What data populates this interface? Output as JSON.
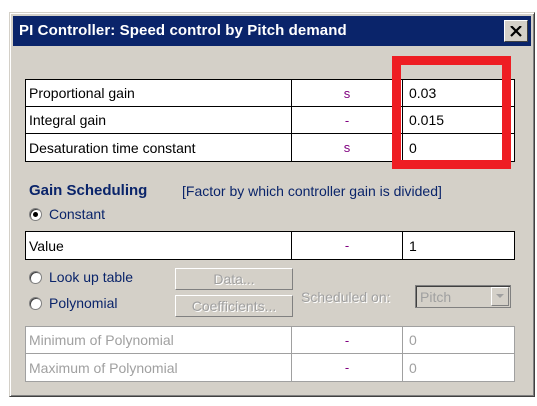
{
  "window": {
    "title": "PI Controller: Speed control by Pitch demand"
  },
  "params": [
    {
      "label": "Proportional gain",
      "unit": "s",
      "value": "0.03"
    },
    {
      "label": "Integral gain",
      "unit": "-",
      "value": "0.015"
    },
    {
      "label": "Desaturation time constant",
      "unit": "s",
      "value": "0"
    }
  ],
  "gain_scheduling": {
    "heading": "Gain Scheduling",
    "note": "[Factor by which controller gain is divided]",
    "constant_label": "Constant",
    "constant_selected": true,
    "value_row": {
      "label": "Value",
      "unit": "-",
      "value": "1"
    },
    "lookup_label": "Look up table",
    "data_button": "Data...",
    "polynomial_label": "Polynomial",
    "coefficients_button": "Coefficients...",
    "scheduled_on_label": "Scheduled on:",
    "scheduled_on_value": "Pitch",
    "poly_rows": [
      {
        "label": "Minimum of Polynomial",
        "unit": "-",
        "value": "0"
      },
      {
        "label": "Maximum of Polynomial",
        "unit": "-",
        "value": "0"
      }
    ]
  },
  "colors": {
    "titlebar": "#0a246a",
    "highlight_box": "#ee1d23",
    "unit_text": "#800080"
  }
}
